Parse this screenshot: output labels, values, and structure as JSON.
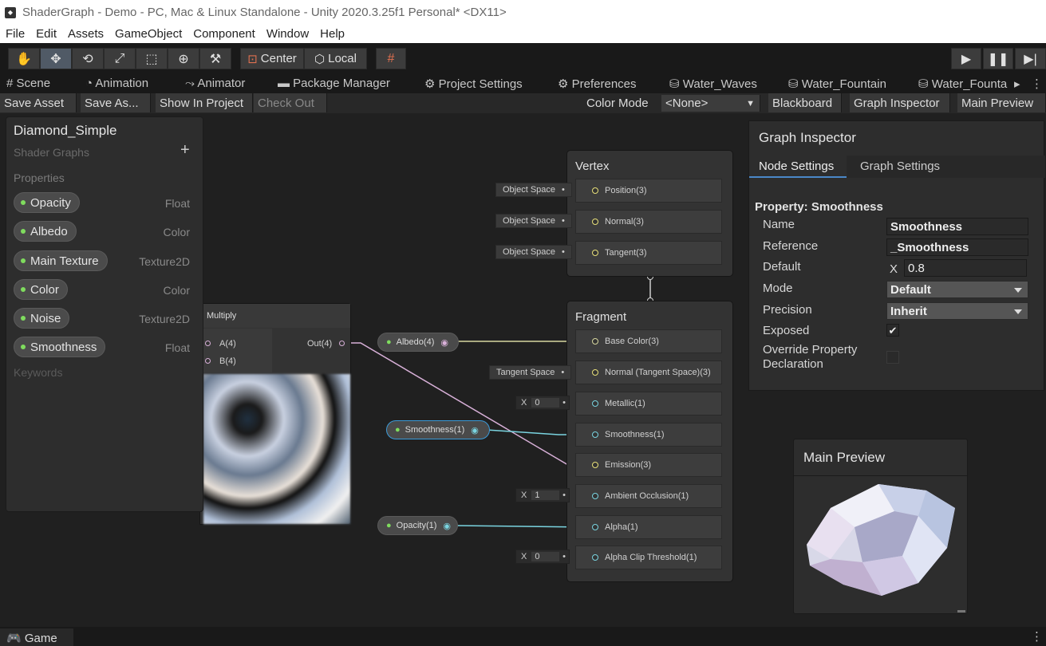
{
  "window": {
    "title": "ShaderGraph - Demo - PC, Mac & Linux Standalone - Unity 2020.3.25f1 Personal* <DX11>"
  },
  "menu": [
    "File",
    "Edit",
    "Assets",
    "GameObject",
    "Component",
    "Window",
    "Help"
  ],
  "toolbar": {
    "pivot": "Center",
    "space": "Local"
  },
  "tabs": [
    "Scene",
    "Animation",
    "Animator",
    "Package Manager",
    "Project Settings",
    "Preferences",
    "Water_Waves",
    "Water_Fountain",
    "Water_Founta"
  ],
  "graph_toolbar": {
    "save_asset": "Save Asset",
    "save_as": "Save As...",
    "show_in_project": "Show In Project",
    "check_out": "Check Out",
    "color_mode_label": "Color Mode",
    "color_mode_value": "<None>",
    "blackboard": "Blackboard",
    "graph_inspector": "Graph Inspector",
    "main_preview": "Main Preview"
  },
  "blackboard": {
    "title": "Diamond_Simple",
    "subtitle": "Shader Graphs",
    "add": "+",
    "properties_label": "Properties",
    "keywords_label": "Keywords",
    "properties": [
      {
        "name": "Opacity",
        "type": "Float"
      },
      {
        "name": "Albedo",
        "type": "Color"
      },
      {
        "name": "Main Texture",
        "type": "Texture2D"
      },
      {
        "name": "Color",
        "type": "Color"
      },
      {
        "name": "Noise",
        "type": "Texture2D"
      },
      {
        "name": "Smoothness",
        "type": "Float"
      }
    ]
  },
  "multiply_node": {
    "title": "Multiply",
    "in_a": "A(4)",
    "in_b": "B(4)",
    "out": "Out(4)"
  },
  "vertex": {
    "title": "Vertex",
    "slots": [
      {
        "label": "Position(3)",
        "input": "Object Space"
      },
      {
        "label": "Normal(3)",
        "input": "Object Space"
      },
      {
        "label": "Tangent(3)",
        "input": "Object Space"
      }
    ]
  },
  "fragment": {
    "title": "Fragment",
    "slots": [
      {
        "label": "Base Color(3)"
      },
      {
        "label": "Normal (Tangent Space)(3)",
        "input": "Tangent Space"
      },
      {
        "label": "Metallic(1)",
        "x": "X",
        "value": "0"
      },
      {
        "label": "Smoothness(1)"
      },
      {
        "label": "Emission(3)"
      },
      {
        "label": "Ambient Occlusion(1)",
        "x": "X",
        "value": "1"
      },
      {
        "label": "Alpha(1)"
      },
      {
        "label": "Alpha Clip Threshold(1)",
        "x": "X",
        "value": "0"
      }
    ]
  },
  "prop_nodes": {
    "albedo": "Albedo(4)",
    "smoothness": "Smoothness(1)",
    "opacity": "Opacity(1)"
  },
  "inspector": {
    "title": "Graph Inspector",
    "tab_node": "Node Settings",
    "tab_graph": "Graph Settings",
    "property_header": "Property: Smoothness",
    "name_label": "Name",
    "name_value": "Smoothness",
    "reference_label": "Reference",
    "reference_value": "_Smoothness",
    "default_label": "Default",
    "default_x": "X",
    "default_value": "0.8",
    "mode_label": "Mode",
    "mode_value": "Default",
    "precision_label": "Precision",
    "precision_value": "Inherit",
    "exposed_label": "Exposed",
    "exposed_check": "✔",
    "override_label_1": "Override Property",
    "override_label_2": "Declaration"
  },
  "main_preview": {
    "title": "Main Preview"
  },
  "status": {
    "game_tab": "Game"
  }
}
